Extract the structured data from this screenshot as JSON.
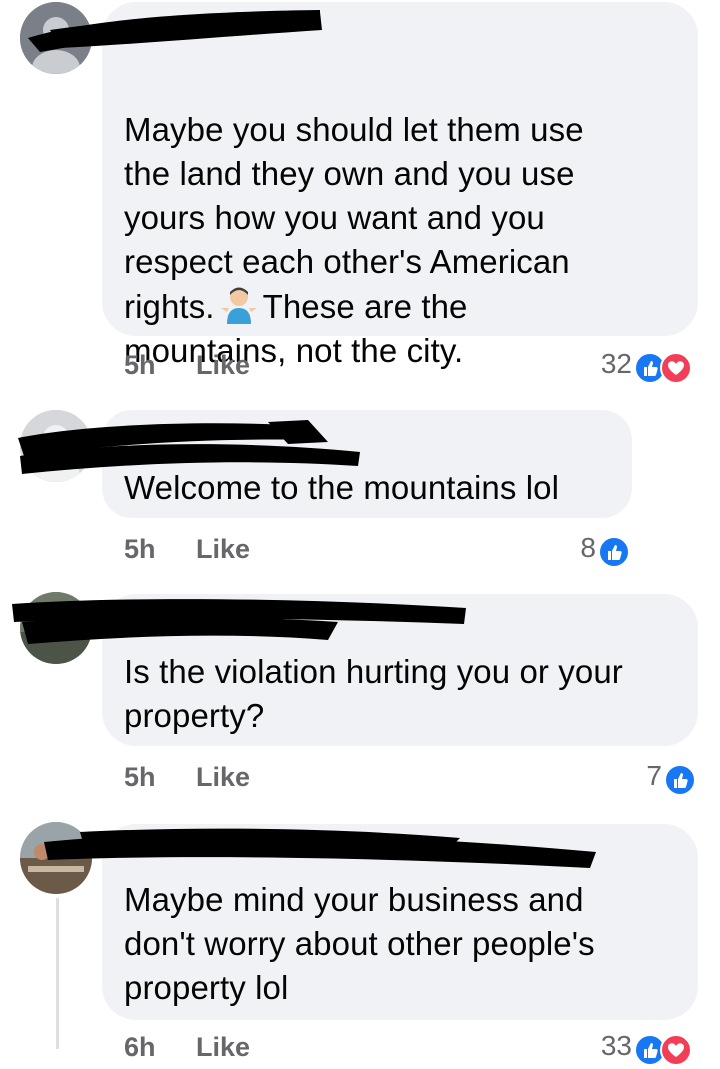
{
  "comments": [
    {
      "body": "Maybe you should let them use\nthe land they own and you use\nyours how you want and you\nrespect each other's American\nrights.",
      "body_tail": "These are the\nmountains, not the city.",
      "emoji": "person-shrugging",
      "time": "5h",
      "like_label": "Like",
      "reaction_count": "32",
      "reactions": [
        "like-icon",
        "love-icon"
      ]
    },
    {
      "body": "Welcome to the mountains lol",
      "time": "5h",
      "like_label": "Like",
      "reaction_count": "8",
      "reactions": [
        "like-icon"
      ]
    },
    {
      "body": "Is the violation hurting you or your\nproperty?",
      "time": "5h",
      "like_label": "Like",
      "reaction_count": "7",
      "reactions": [
        "like-icon"
      ]
    },
    {
      "body": "Maybe mind your business and\ndon't worry about other people's\nproperty lol",
      "time": "6h",
      "like_label": "Like",
      "reaction_count": "33",
      "reactions": [
        "like-icon",
        "love-icon"
      ]
    }
  ],
  "colors": {
    "bubble": "#f0f2f5",
    "meta_text": "#65676b",
    "like_blue": "#1877f2",
    "love_red": "#f33e58",
    "redaction": "#000000"
  }
}
